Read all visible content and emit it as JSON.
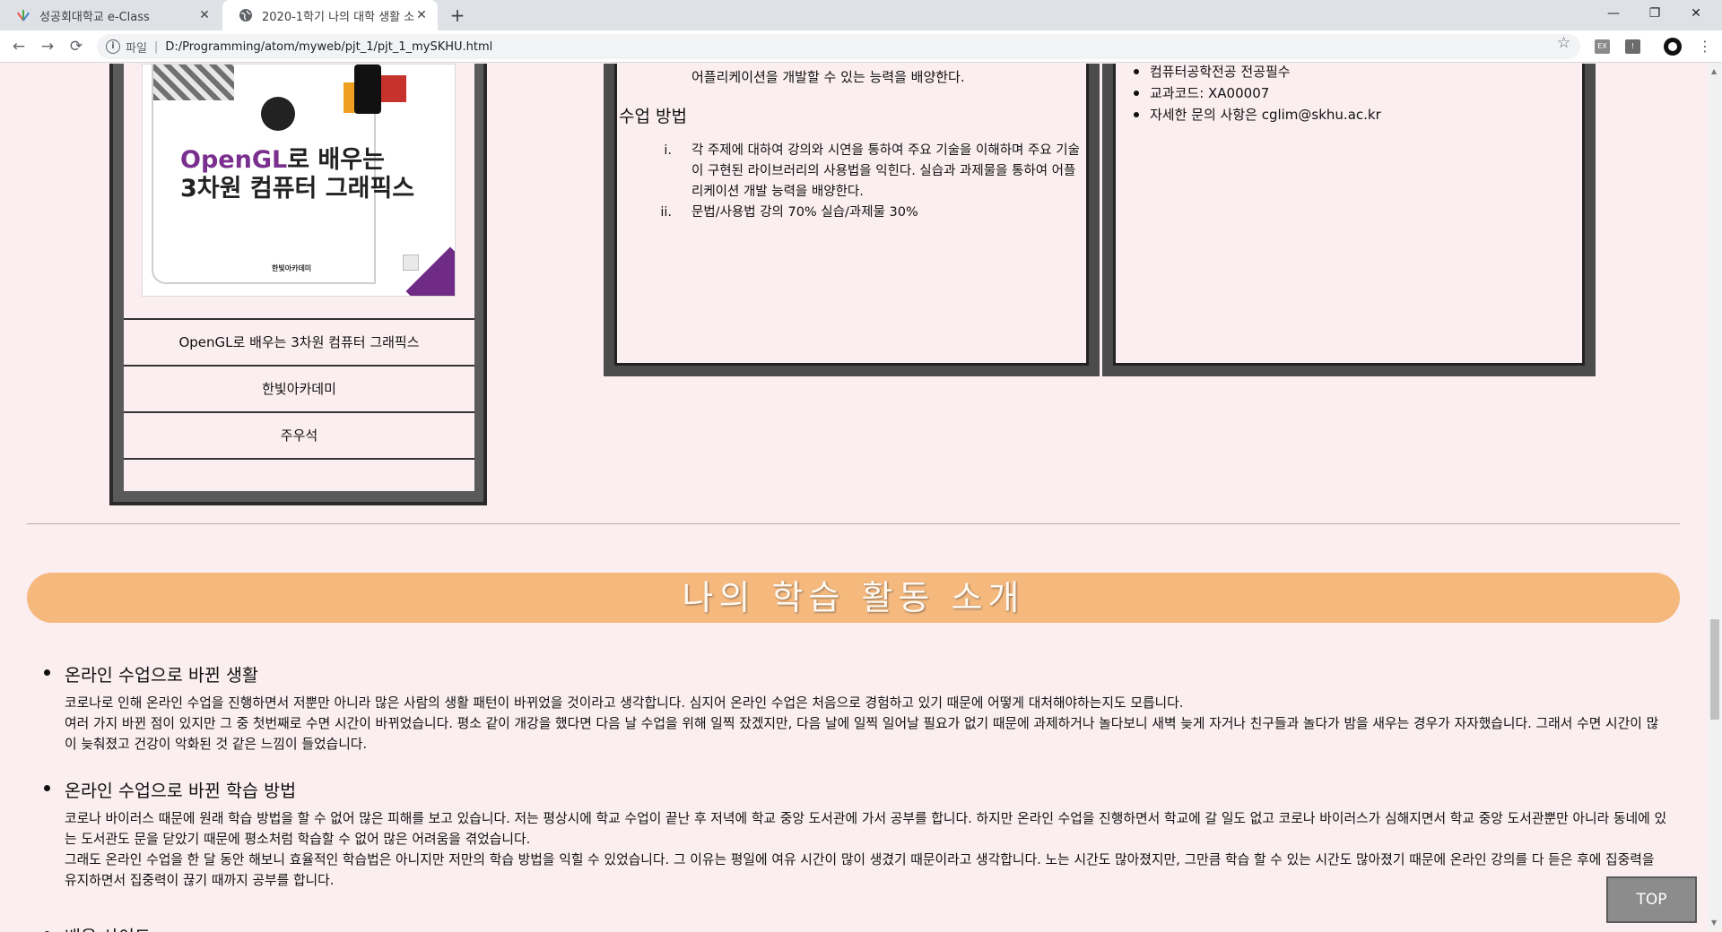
{
  "browser": {
    "tabs": [
      {
        "title": "성공회대학교 e-Class",
        "active": false
      },
      {
        "title": "2020-1학기 나의 대학 생활 소개",
        "active": true
      }
    ],
    "new_tab": "+",
    "close": "✕",
    "window_controls": {
      "minimize": "—",
      "restore": "❐",
      "close": "✕"
    },
    "nav": {
      "back": "←",
      "forward": "→",
      "reload": "⟳"
    },
    "address": {
      "scheme_label": "파일",
      "separator": "|",
      "url": "D:/Programming/atom/myweb/pjt_1/pjt_1_mySKHU.html"
    },
    "star": "☆",
    "extensions": [
      "EX",
      "!"
    ],
    "menu": "⋮"
  },
  "book": {
    "cover": {
      "title_en": "OpenGL",
      "title_rest": "로 배우는",
      "title_line2": "3차원 컴퓨터 그래픽스",
      "publisher_logo": "한빛아카데미"
    },
    "title": "OpenGL로 배우는 3차원 컴퓨터 그래픽스",
    "publisher": "한빛아카데미",
    "author": "주우석"
  },
  "course": {
    "goal_tail": "어플리케이션을 개발할 수 있는 능력을 배양한다.",
    "method_heading": "수업 방법",
    "methods": [
      {
        "num": "i.",
        "text": "각 주제에 대하여 강의와 시연을 통하여 주요 기술을 이해하며 주요 기술이 구현된 라이브러리의 사용법을 익힌다. 실습과 과제물을 통하여 어플리케이션 개발 능력을 배양한다."
      },
      {
        "num": "ii.",
        "text": "문법/사용법 강의 70% 실습/과제물 30%"
      }
    ],
    "info": [
      "컴퓨터공학전공 전공필수",
      "교과코드: XA00007",
      "자세한 문의 사항은 cglim@skhu.ac.kr"
    ]
  },
  "section": {
    "banner": "나의 학습 활동 소개",
    "items": [
      {
        "heading": "온라인 수업으로 바뀐 생활",
        "paragraphs": [
          "코로나로 인해 온라인 수업을 진행하면서 저뿐만 아니라 많은 사람의 생활 패턴이 바뀌었을 것이라고 생각합니다. 심지어 온라인 수업은 처음으로 경험하고 있기 때문에 어떻게 대처해야하는지도 모릅니다.",
          "여러 가지 바뀐 점이 있지만 그 중 첫번째로 수면 시간이 바뀌었습니다. 평소 같이 개강을 했다면 다음 날 수업을 위해 일찍 잤겠지만, 다음 날에 일찍 일어날 필요가 없기 때문에 과제하거나 놀다보니 새벽 늦게 자거나 친구들과 놀다가 밤을 새우는 경우가 자자했습니다. 그래서 수면 시간이 많이 늦춰졌고 건강이 악화된 것 같은 느낌이 들었습니다."
        ]
      },
      {
        "heading": "온라인 수업으로 바뀐 학습 방법",
        "paragraphs": [
          "코로나 바이러스 때문에 원래 학습 방법을 할 수 없어 많은 피해를 보고 있습니다. 저는 평상시에 학교 수업이 끝난 후 저녁에 학교 중앙 도서관에 가서 공부를 합니다. 하지만 온라인 수업을 진행하면서 학교에 갈 일도 없고 코로나 바이러스가 심해지면서 학교 중앙 도서관뿐만 아니라 동네에 있는 도서관도 문을 닫았기 때문에 평소처럼 학습할 수 없어 많은 어려움을 겪었습니다.",
          "그래도 온라인 수업을 한 달 동안 해보니 효율적인 학습법은 아니지만 저만의 학습 방법을 익힐 수 있었습니다. 그 이유는 평일에 여유 시간이 많이 생겼기 때문이라고 생각합니다. 노는 시간도 많아졌지만, 그만큼 학습 할 수 있는 시간도 많아졌기 때문에 온라인 강의를 다 듣은 후에 집중력을 유지하면서 집중력이 끊기 때까지 공부를 합니다."
        ]
      },
      {
        "heading": "배움 사이트"
      }
    ]
  },
  "top_button": "TOP",
  "colors": {
    "banner": "#f5b97e",
    "page_bg": "#fbeef0",
    "box_frame": "#4b4b4b",
    "top_button": "#8c8c8c"
  },
  "icons": {
    "tab1": "eclass-favicon",
    "tab2": "globe-icon",
    "github": "github-icon"
  }
}
